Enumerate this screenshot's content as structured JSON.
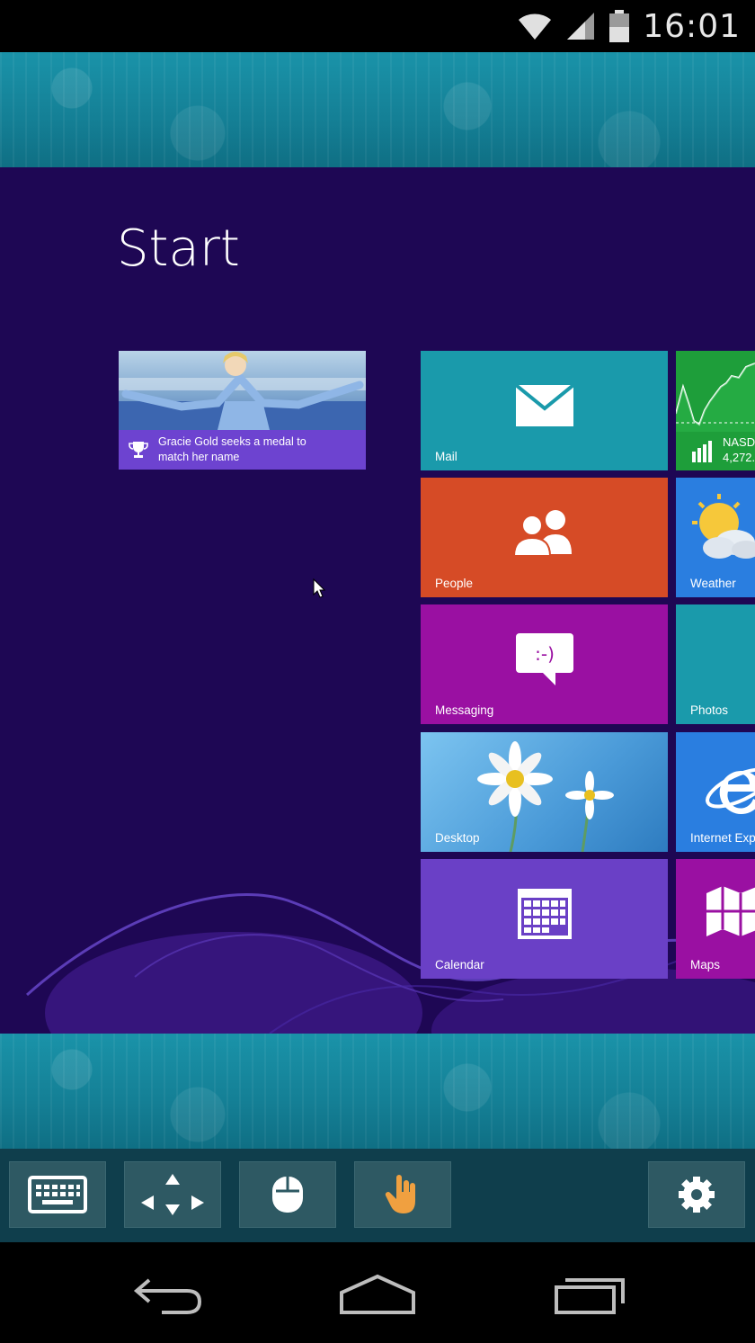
{
  "status_bar": {
    "time": "16:01",
    "icons": [
      "wifi-icon",
      "signal-icon",
      "battery-icon"
    ]
  },
  "start_screen": {
    "title": "Start",
    "news_tile": {
      "headline": "Gracie Gold seeks a medal to match her name",
      "icon": "trophy-icon"
    },
    "tiles": [
      {
        "label": "Mail",
        "icon": "mail-icon",
        "color": "#1a9aab"
      },
      {
        "label": "NASDAQ",
        "value": "4,272.",
        "icon": "finance-chart-icon",
        "color": "#1e9e3a"
      },
      {
        "label": "People",
        "icon": "people-icon",
        "color": "#d64b26"
      },
      {
        "label": "Weather",
        "icon": "weather-icon",
        "color": "#2a7ee0"
      },
      {
        "label": "Messaging",
        "icon": "messaging-icon",
        "color": "#9a10a2"
      },
      {
        "label": "Photos",
        "icon": "photos-icon",
        "color": "#1a9aab"
      },
      {
        "label": "Desktop",
        "icon": "desktop-wallpaper",
        "color": "#4aa0dc"
      },
      {
        "label": "Internet Expl",
        "icon": "internet-explorer-icon",
        "color": "#2a7ee0"
      },
      {
        "label": "Calendar",
        "icon": "calendar-icon",
        "color": "#6a40c6"
      },
      {
        "label": "Maps",
        "icon": "maps-icon",
        "color": "#9a10a2"
      }
    ]
  },
  "toolbar": {
    "buttons": [
      "keyboard-icon",
      "arrows-icon",
      "mouse-icon",
      "touch-hand-icon",
      "gear-icon"
    ],
    "accent": "#f0a040"
  },
  "nav_bar": {
    "buttons": [
      "back-icon",
      "home-icon",
      "recents-icon"
    ]
  }
}
